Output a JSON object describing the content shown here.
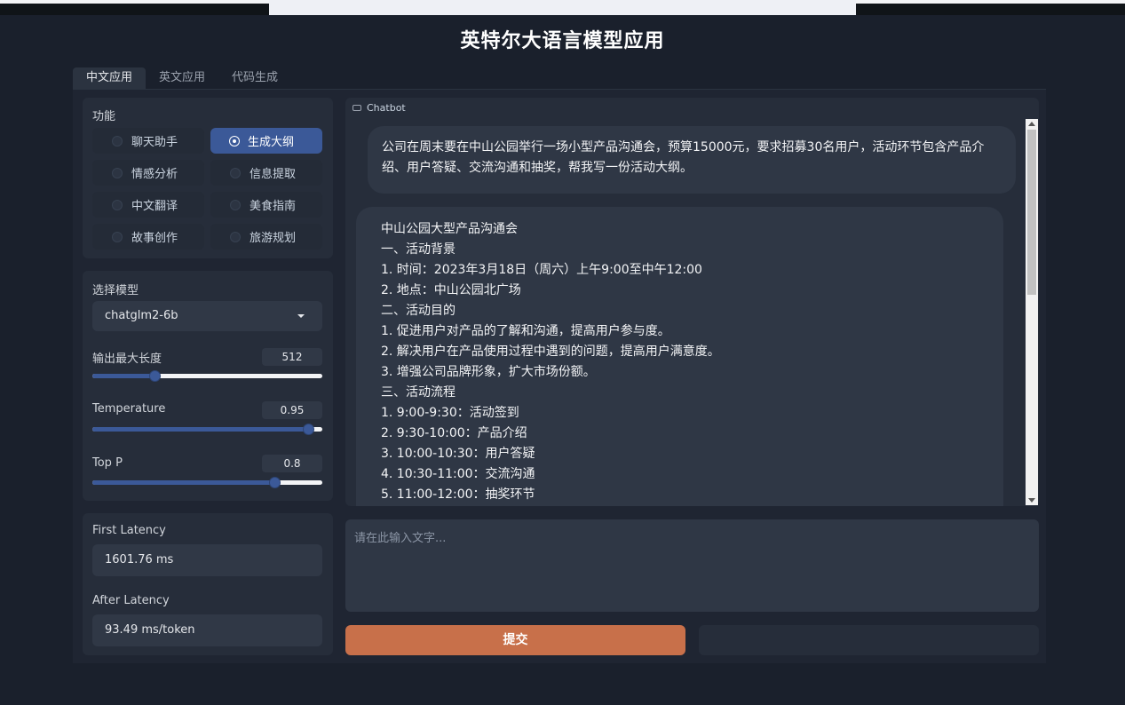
{
  "app_title": "英特尔大语言模型应用",
  "tabs": [
    {
      "label": "中文应用",
      "active": true
    },
    {
      "label": "英文应用",
      "active": false
    },
    {
      "label": "代码生成",
      "active": false
    }
  ],
  "function_panel": {
    "label": "功能",
    "options": [
      "聊天助手",
      "生成大纲",
      "情感分析",
      "信息提取",
      "中文翻译",
      "美食指南",
      "故事创作",
      "旅游规划"
    ],
    "selected": "生成大纲"
  },
  "model_panel": {
    "label": "选择模型",
    "selected_model": "chatglm2-6b",
    "max_length": {
      "label": "输出最大长度",
      "value": "512",
      "fraction": 0.27
    },
    "temperature": {
      "label": "Temperature",
      "value": "0.95",
      "fraction": 0.94
    },
    "top_p": {
      "label": "Top P",
      "value": "0.8",
      "fraction": 0.79
    }
  },
  "latency_panel": {
    "first_label": "First Latency",
    "first_value": "1601.76 ms",
    "after_label": "After Latency",
    "after_value": "93.49 ms/token"
  },
  "chatbot": {
    "label": "Chatbot",
    "user_message_lines": [
      "公司在周末要在中山公园举行一场小型产品沟通会，预算15000元，要求招募30名用户，活动环节包含产品介",
      "绍、用户答疑、交流沟通和抽奖，帮我写一份活动大纲。"
    ],
    "bot_message_lines": [
      "中山公园大型产品沟通会",
      "一、活动背景",
      "1. 时间：2023年3月18日（周六）上午9:00至中午12:00",
      "2. 地点：中山公园北广场",
      "二、活动目的",
      "1. 促进用户对产品的了解和沟通，提高用户参与度。",
      "2. 解决用户在产品使用过程中遇到的问题，提高用户满意度。",
      "3. 增强公司品牌形象，扩大市场份额。",
      "三、活动流程",
      "1. 9:00-9:30：活动签到",
      "2. 9:30-10:00：产品介绍",
      "3. 10:00-10:30：用户答疑",
      "4. 10:30-11:00：交流沟通",
      "5. 11:00-12:00：抽奖环节"
    ]
  },
  "input": {
    "placeholder": "请在此输入文字..."
  },
  "submit_label": "提交"
}
